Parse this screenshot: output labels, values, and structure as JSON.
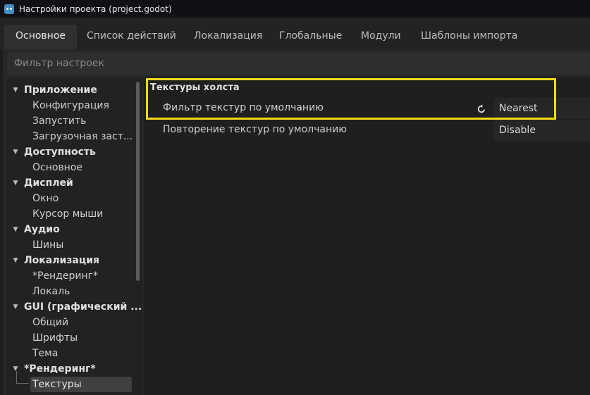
{
  "window": {
    "title": "Настройки проекта (project.godot)"
  },
  "tabs": [
    {
      "label": "Основное"
    },
    {
      "label": "Список действий"
    },
    {
      "label": "Локализация"
    },
    {
      "label": "Глобальные"
    },
    {
      "label": "Модули"
    },
    {
      "label": "Шаблоны импорта"
    }
  ],
  "filter": {
    "placeholder": "Фильтр настроек"
  },
  "tree": [
    {
      "kind": "section",
      "label": "Приложение"
    },
    {
      "kind": "item",
      "label": "Конфигурация"
    },
    {
      "kind": "item",
      "label": "Запустить"
    },
    {
      "kind": "item",
      "label": "Загрузочная заст..."
    },
    {
      "kind": "section",
      "label": "Доступность"
    },
    {
      "kind": "item",
      "label": "Основное"
    },
    {
      "kind": "section",
      "label": "Дисплей"
    },
    {
      "kind": "item",
      "label": "Окно"
    },
    {
      "kind": "item",
      "label": "Курсор мыши"
    },
    {
      "kind": "section",
      "label": "Аудио"
    },
    {
      "kind": "item",
      "label": "Шины"
    },
    {
      "kind": "section",
      "label": "Локализация"
    },
    {
      "kind": "item",
      "label": "*Рендеринг*"
    },
    {
      "kind": "item",
      "label": "Локаль"
    },
    {
      "kind": "section",
      "label": "GUI (графический ..."
    },
    {
      "kind": "item",
      "label": "Общий"
    },
    {
      "kind": "item",
      "label": "Шрифты"
    },
    {
      "kind": "item",
      "label": "Тема"
    },
    {
      "kind": "section",
      "label": "*Рендеринг*"
    },
    {
      "kind": "item",
      "label": "Текстуры",
      "selected": true
    }
  ],
  "inspector": {
    "group_title": "Текстуры холста",
    "properties": [
      {
        "label": "Фильтр текстур по умолчанию",
        "value": "Nearest",
        "revert_icon": "revert-icon"
      },
      {
        "label": "Повторение текстур по умолчанию",
        "value": "Disable"
      }
    ]
  },
  "colors": {
    "highlight": "#f2d91a",
    "selection": "#404040",
    "godot_icon": "#478cbf"
  }
}
